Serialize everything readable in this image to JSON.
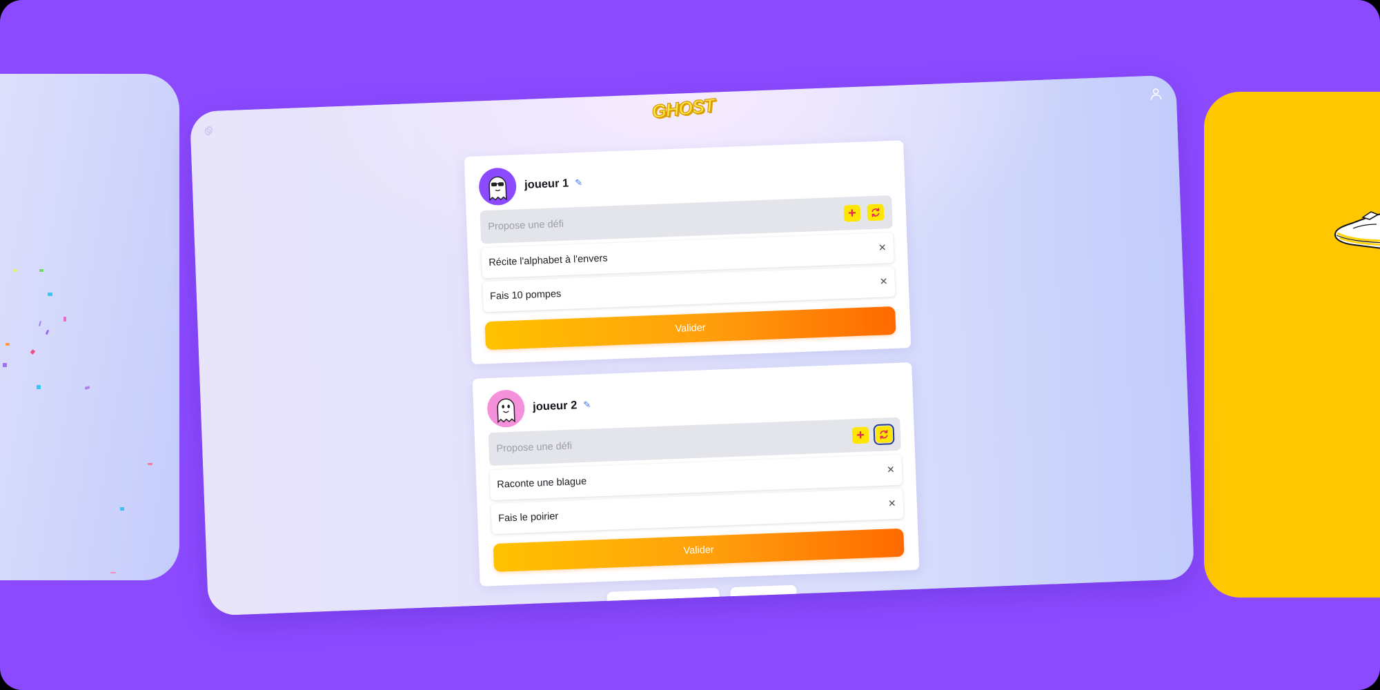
{
  "app": {
    "logo_text": "GHOST"
  },
  "icons": {
    "settings": "gear-icon",
    "account": "user-icon",
    "edit": "pencil-icon",
    "add": "plus-icon",
    "regenerate": "refresh-icon",
    "remove": "close-icon",
    "player1_avatar": "ghost-sunglasses-icon",
    "player2_avatar": "ghost-icon",
    "next_card_art": "sneaker-illustration"
  },
  "colors": {
    "page_background": "#8B4AFF",
    "icon_button": "#FFE600",
    "icon_glyph": "#E2245C",
    "submit_gradient_start": "#FFC200",
    "submit_gradient_end": "#FF6A00",
    "next_card": "#FFC700",
    "player1_avatar_bg": "#8B4AFF",
    "player2_avatar_bg": "#F590DA",
    "focus_ring": "#24388F"
  },
  "players": [
    {
      "name": "joueur 1",
      "edit_glyph": "✎",
      "challenge_input": {
        "placeholder": "Propose une défi",
        "value": ""
      },
      "add_glyph": "+",
      "challenges": [
        "Récite l'alphabet à l'envers",
        "Fais 10 pompes"
      ],
      "remove_glyph": "✕",
      "submit_label": "Valider"
    },
    {
      "name": "joueur 2",
      "edit_glyph": "✎",
      "challenge_input": {
        "placeholder": "Propose une défi",
        "value": ""
      },
      "add_glyph": "+",
      "challenges": [
        "Raconte une blague",
        "Fais le poirier"
      ],
      "remove_glyph": "✕",
      "submit_label": "Valider"
    }
  ]
}
